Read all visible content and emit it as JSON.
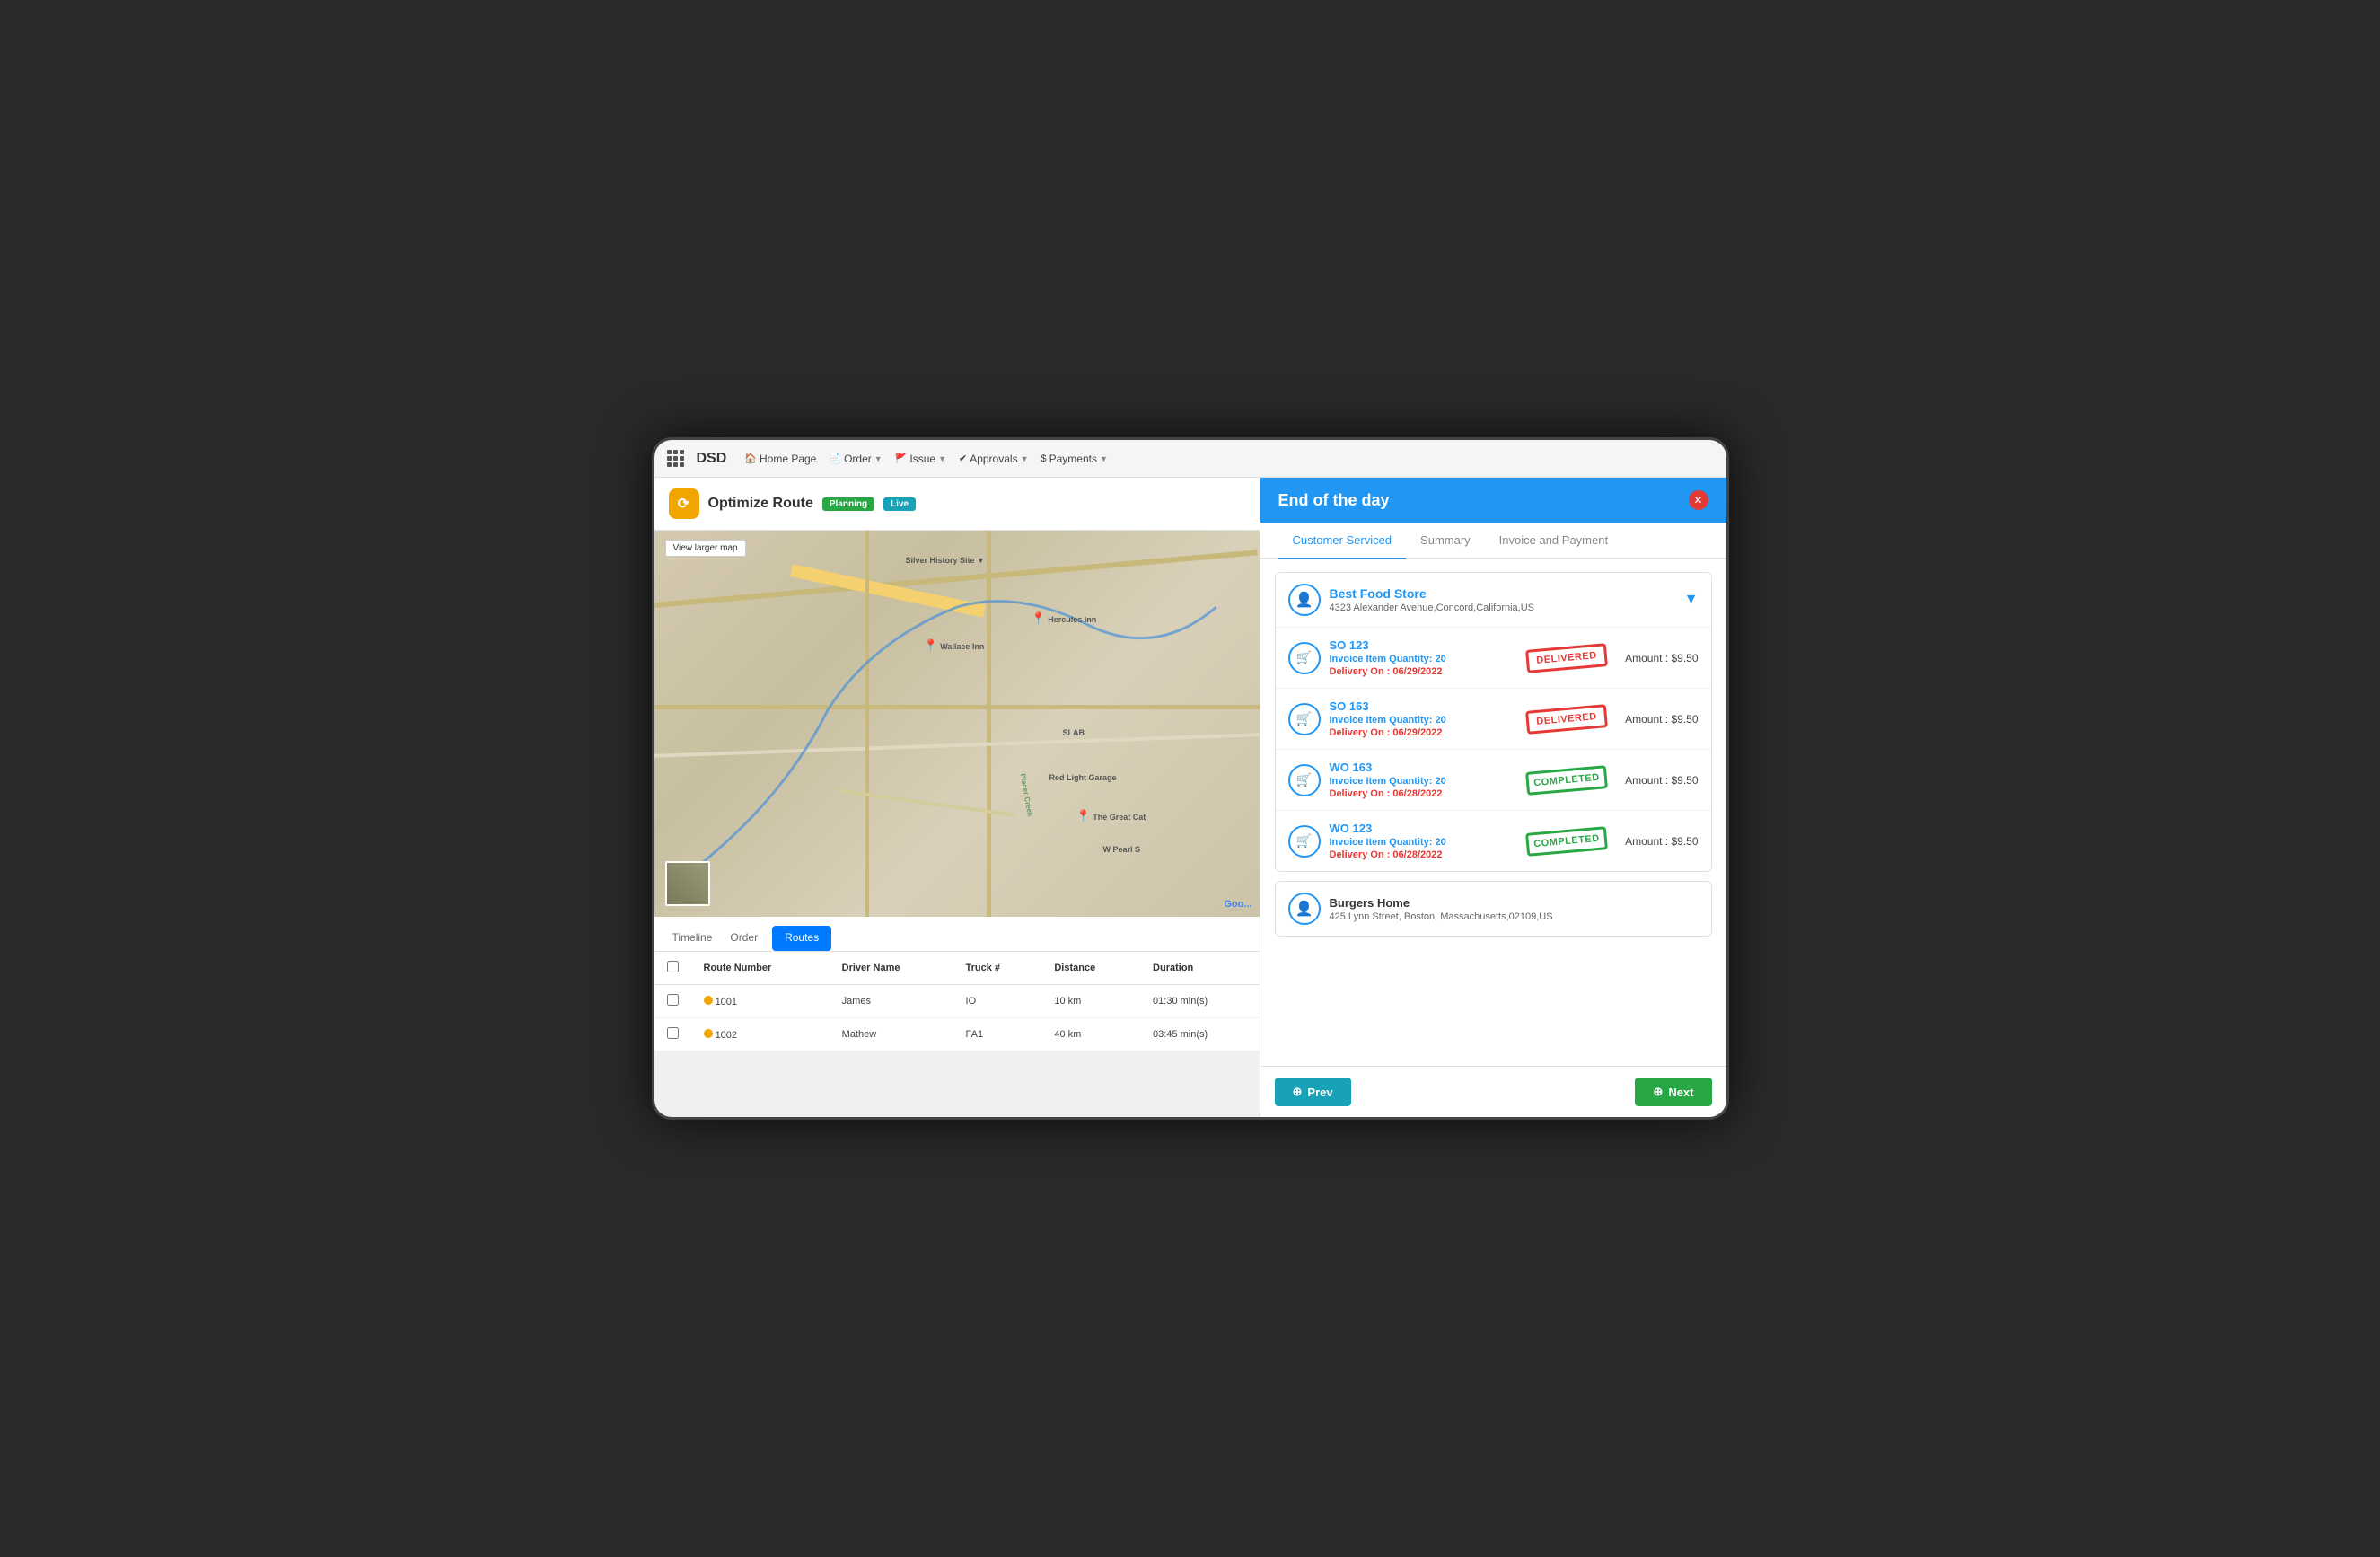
{
  "app": {
    "title": "DSD",
    "nav": [
      {
        "label": "Home Page",
        "icon": "home",
        "hasDropdown": false
      },
      {
        "label": "Order",
        "icon": "order",
        "hasDropdown": true
      },
      {
        "label": "Issue",
        "icon": "issue",
        "hasDropdown": true
      },
      {
        "label": "Approvals",
        "icon": "approvals",
        "hasDropdown": true
      },
      {
        "label": "Payments",
        "icon": "payments",
        "hasDropdown": true
      }
    ]
  },
  "route": {
    "title": "Optimize Route",
    "badges": [
      "Planning",
      "Live"
    ],
    "view_larger_map": "View larger map",
    "google_text": "Goo..."
  },
  "bottom_tabs": [
    {
      "label": "Timeline",
      "active": false
    },
    {
      "label": "Order",
      "active": false
    },
    {
      "label": "Routes",
      "active": true
    }
  ],
  "table": {
    "headers": [
      "Route Number",
      "Driver Name",
      "Truck #",
      "Distance",
      "Duration"
    ],
    "rows": [
      {
        "number": "1001",
        "driver": "James",
        "truck": "IO",
        "distance": "10 km",
        "duration": "01:30 min(s)",
        "color": "#f0a500"
      },
      {
        "number": "1002",
        "driver": "Mathew",
        "truck": "FA1",
        "distance": "40 km",
        "duration": "03:45 min(s)",
        "color": "#f0a500"
      }
    ]
  },
  "modal": {
    "title": "End of the day",
    "tabs": [
      {
        "label": "Customer Serviced",
        "active": true
      },
      {
        "label": "Summary",
        "active": false
      },
      {
        "label": "Invoice and Payment",
        "active": false
      }
    ],
    "customers": [
      {
        "name": "Best Food Store",
        "address": "4323 Alexander Avenue,Concord,California,US",
        "orders": [
          {
            "id": "SO 123",
            "qty": "20",
            "delivery_on": "06/29/2022",
            "status": "DELIVERED",
            "status_type": "delivered",
            "amount": "$9.50"
          },
          {
            "id": "SO 163",
            "qty": "20",
            "delivery_on": "06/29/2022",
            "status": "DELIVERED",
            "status_type": "delivered",
            "amount": "$9.50"
          },
          {
            "id": "WO 163",
            "qty": "20",
            "delivery_on": "06/28/2022",
            "status": "COMPLETED",
            "status_type": "completed",
            "amount": "$9.50"
          },
          {
            "id": "WO 123",
            "qty": "20",
            "delivery_on": "06/28/2022",
            "status": "COMPLETED",
            "status_type": "completed",
            "amount": "$9.50"
          }
        ]
      }
    ],
    "second_customer": {
      "name": "Burgers Home",
      "address": "425 Lynn Street, Boston, Massachusetts,02109,US"
    },
    "labels": {
      "invoice_item_qty": "Invoice Item Quantity: ",
      "delivery_on": "Delivery On : ",
      "amount_prefix": "Amount : "
    },
    "footer": {
      "prev_label": "Prev",
      "next_label": "Next"
    }
  },
  "map_labels": {
    "silver_history": "Silver History Site",
    "wallace_inn": "Wallace Inn",
    "hercules_inn": "Hercules Inn",
    "red_light": "Red Light Garage",
    "the_great_cat": "The Great Cat",
    "slab": "SLAB",
    "w_pearl": "W Pearl S",
    "placer_creek": "Placer Creek"
  }
}
